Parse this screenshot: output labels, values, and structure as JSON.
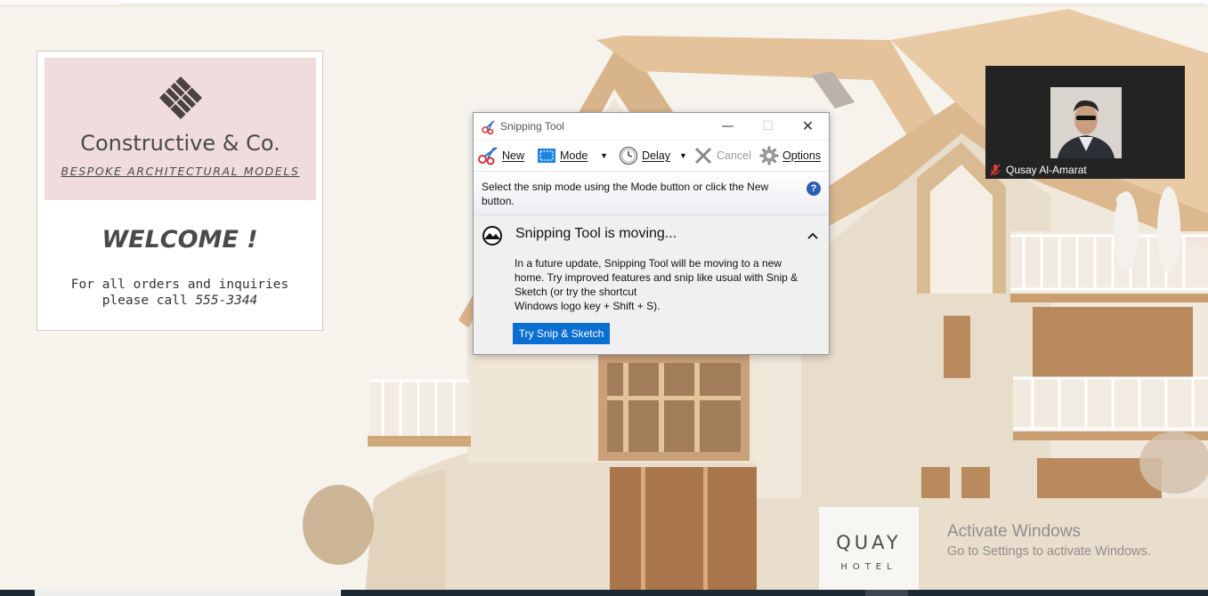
{
  "card": {
    "brand": "Constructive & Co.",
    "tagline": "BESPOKE ARCHITECTURAL MODELS",
    "welcome": "WELCOME !",
    "line1": "For all orders and inquiries",
    "line2_prefix": "please call ",
    "phone": "555-3344",
    "banner_color": "#f0dcdc"
  },
  "snipping_tool": {
    "title": "Snipping Tool",
    "window_controls": {
      "minimize": "—",
      "maximize": "☐",
      "close": "✕"
    },
    "toolbar": {
      "new": "New",
      "mode": "Mode",
      "delay": "Delay",
      "cancel": "Cancel",
      "options": "Options",
      "dropdown_glyph": "▼"
    },
    "hint": "Select the snip mode using the Mode button or click the New button.",
    "help_glyph": "?",
    "notice_title": "Snipping Tool is moving...",
    "notice_body_1": "In a future update, Snipping Tool will be moving to a new home. Try improved features and snip like usual with Snip & Sketch (or try the shortcut",
    "notice_body_2": "Windows logo key + Shift + S).",
    "try_button": "Try Snip & Sketch",
    "accent": "#0a6fd0"
  },
  "video": {
    "participant": "Qusay Al-Amarat",
    "muted": true
  },
  "sign": {
    "name": "QUAY",
    "sub": "HOTEL"
  },
  "watermark": {
    "title": "Activate Windows",
    "subtitle": "Go to Settings to activate Windows."
  }
}
